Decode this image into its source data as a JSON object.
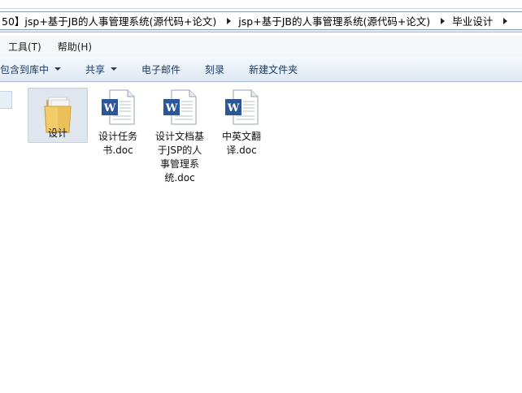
{
  "address": {
    "crumbs": [
      "50】jsp+基于JB的人事管理系统(源代码+论文)",
      "jsp+基于JB的人事管理系统(源代码+论文)",
      "毕业设计"
    ]
  },
  "menubar": {
    "tools": "工具(T)",
    "help": "帮助(H)"
  },
  "commandbar": {
    "include_library": "包含到库中",
    "share": "共享",
    "email": "电子邮件",
    "burn": "刻录",
    "new_folder": "新建文件夹"
  },
  "files": [
    {
      "name": "设计",
      "type": "folder"
    },
    {
      "name": "设计任务书.doc",
      "type": "doc"
    },
    {
      "name": "设计文档基于JSP的人事管理系统.doc",
      "type": "doc"
    },
    {
      "name": "中英文翻译.doc",
      "type": "doc"
    }
  ],
  "colors": {
    "word_blue": "#2b5797",
    "folder_yellow": "#e9c46a",
    "command_text": "#1e3c64"
  }
}
